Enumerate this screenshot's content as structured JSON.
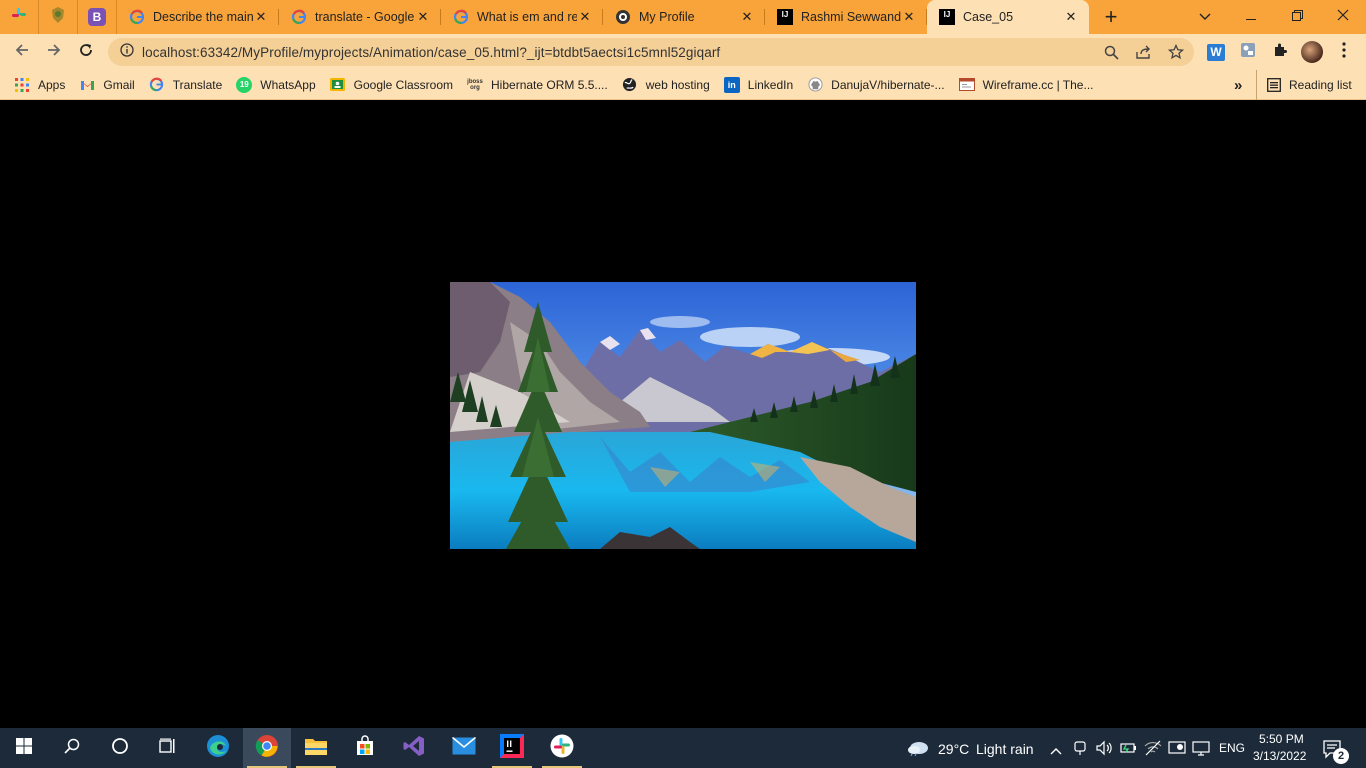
{
  "browser": {
    "pinned_tabs": [
      {
        "icon": "slack-icon"
      },
      {
        "icon": "crest-icon"
      },
      {
        "icon": "bootstrap-icon",
        "letter": "B"
      }
    ],
    "tabs": [
      {
        "title": "Describe the main",
        "icon": "google-icon",
        "active": false
      },
      {
        "title": "translate - Google",
        "icon": "google-icon",
        "active": false
      },
      {
        "title": "What is em and re",
        "icon": "google-icon",
        "active": false
      },
      {
        "title": "My Profile",
        "icon": "globe-icon",
        "active": false
      },
      {
        "title": "Rashmi Sewwandi",
        "icon": "intellij-icon",
        "active": false
      },
      {
        "title": "Case_05",
        "icon": "intellij-icon",
        "active": true
      }
    ],
    "close_glyph": "✕",
    "new_tab_glyph": "+",
    "intellij_letters": "IJ",
    "url": "localhost:63342/MyProfile/myprojects/Animation/case_05.html?_ijt=btdbt5aectsi1c5mnl52giqarf",
    "extension_word_letter": "W"
  },
  "bookmarks": {
    "items": [
      {
        "label": "Apps",
        "icon": "apps-grid-icon"
      },
      {
        "label": "Gmail",
        "icon": "gmail-icon"
      },
      {
        "label": "Translate",
        "icon": "google-icon"
      },
      {
        "label": "WhatsApp",
        "icon": "whatsapp-icon",
        "badge": "19"
      },
      {
        "label": "Google Classroom",
        "icon": "classroom-icon"
      },
      {
        "label": "Hibernate ORM 5.5....",
        "icon": "jboss-icon",
        "badge": "jboss\norg"
      },
      {
        "label": "web hosting",
        "icon": "globe-icon"
      },
      {
        "label": "LinkedIn",
        "icon": "linkedin-icon",
        "badge": "in"
      },
      {
        "label": "DanujaV/hibernate-...",
        "icon": "github-icon"
      },
      {
        "label": "Wireframe.cc | The...",
        "icon": "wireframe-icon"
      }
    ],
    "more_glyph": "»",
    "reading_list": "Reading list"
  },
  "page": {
    "image": "mountain-lake-landscape"
  },
  "taskbar": {
    "weather_temp": "29°C",
    "weather_desc": "Light rain",
    "language": "ENG",
    "time": "5:50 PM",
    "date": "3/13/2022",
    "notification_count": "2"
  }
}
